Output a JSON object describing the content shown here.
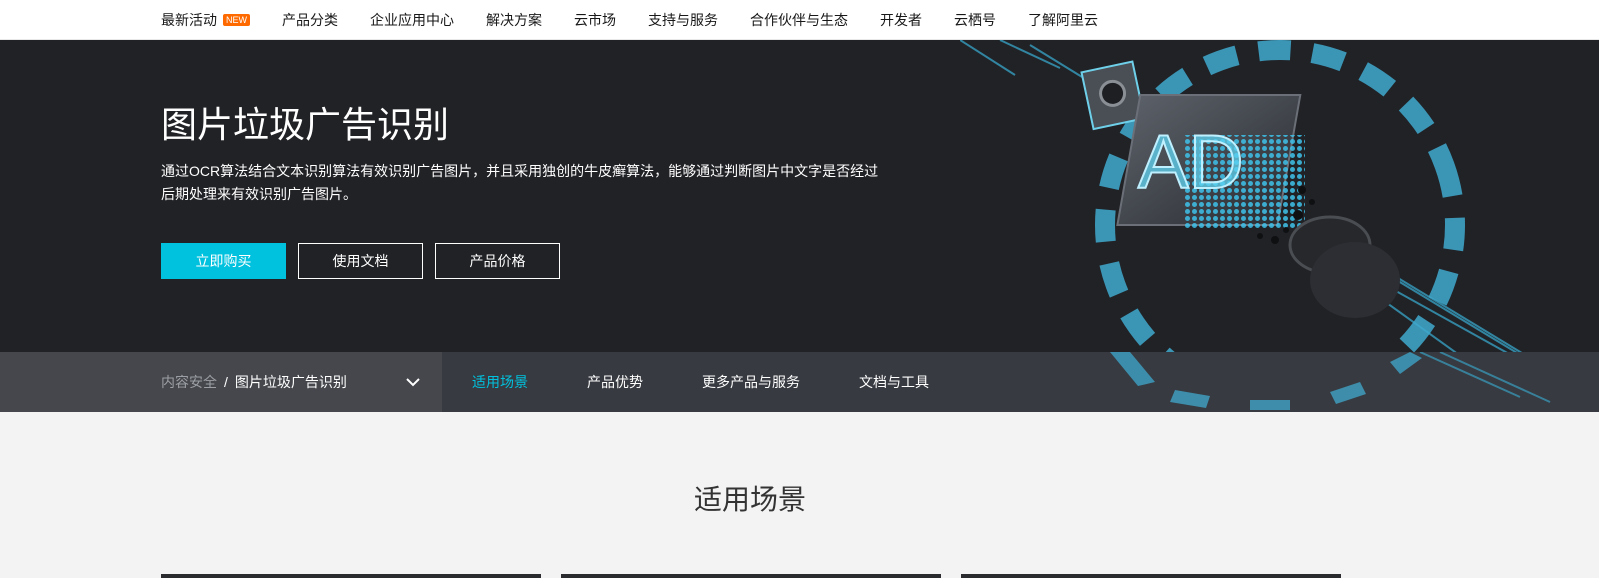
{
  "topnav": {
    "items": [
      {
        "label": "最新活动",
        "badge": "NEW"
      },
      {
        "label": "产品分类"
      },
      {
        "label": "企业应用中心"
      },
      {
        "label": "解决方案"
      },
      {
        "label": "云市场"
      },
      {
        "label": "支持与服务"
      },
      {
        "label": "合作伙伴与生态"
      },
      {
        "label": "开发者"
      },
      {
        "label": "云栖号"
      },
      {
        "label": "了解阿里云"
      }
    ]
  },
  "hero": {
    "title": "图片垃圾广告识别",
    "description": "通过OCR算法结合文本识别算法有效识别广告图片，并且采用独创的牛皮癣算法，能够通过判断图片中文字是否经过后期处理来有效识别广告图片。",
    "art_text": "AD",
    "buttons": {
      "buy": "立即购买",
      "docs": "使用文档",
      "price": "产品价格"
    }
  },
  "subnav": {
    "breadcrumb": {
      "parent": "内容安全",
      "separator": "/",
      "current": "图片垃圾广告识别"
    },
    "tabs": [
      {
        "label": "适用场景",
        "active": true
      },
      {
        "label": "产品优势",
        "active": false
      },
      {
        "label": "更多产品与服务",
        "active": false
      },
      {
        "label": "文档与工具",
        "active": false
      }
    ]
  },
  "content": {
    "section_title": "适用场景"
  },
  "colors": {
    "accent": "#00c1de",
    "new_badge": "#ff6a00",
    "hero_bg": "#212226",
    "subnav_bg": "#373a40"
  }
}
